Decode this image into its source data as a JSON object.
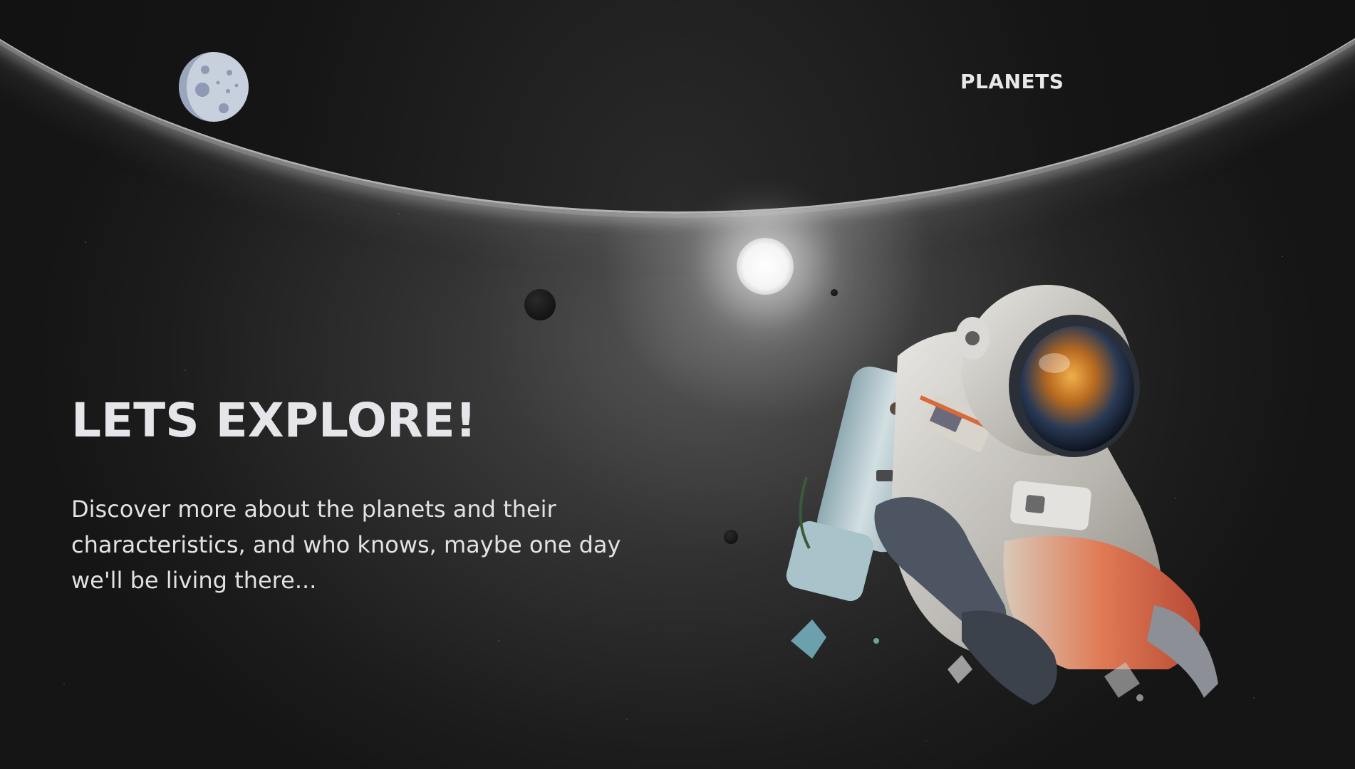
{
  "header": {
    "logo_icon": "moon-icon",
    "nav": [
      {
        "label": "PLANETS"
      }
    ]
  },
  "hero": {
    "title": "LETS EXPLORE!",
    "description": "Discover more about the planets and their characteristics, and who knows, maybe one day we'll be living there..."
  },
  "illustration": {
    "icon": "astronaut-illustration"
  },
  "colors": {
    "background": "#1c1c1c",
    "text": "#e6e6ea",
    "moon": "#c9d0dd",
    "moon_crater": "#8e99b3"
  }
}
